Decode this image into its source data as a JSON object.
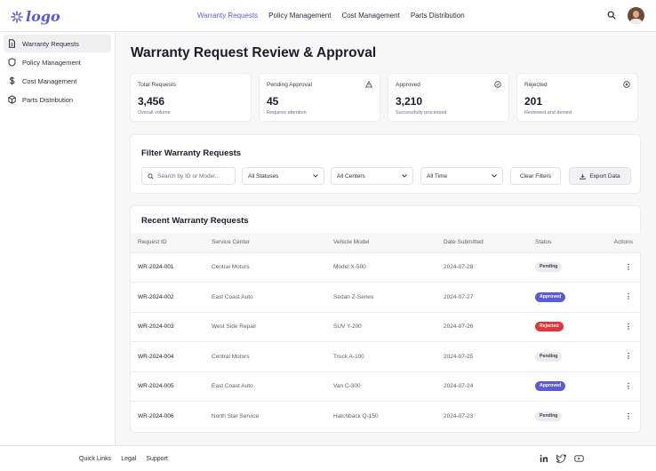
{
  "brand": {
    "logo_text": "logo",
    "accent": "#5b5bd6"
  },
  "topnav": {
    "items": [
      {
        "label": "Warranty Requests",
        "active": true
      },
      {
        "label": "Policy Management",
        "active": false
      },
      {
        "label": "Cost Management",
        "active": false
      },
      {
        "label": "Parts Distribution",
        "active": false
      }
    ],
    "icons": [
      "search-icon",
      "avatar"
    ]
  },
  "sidebar": {
    "items": [
      {
        "label": "Warranty Requests",
        "icon": "document-icon",
        "active": true
      },
      {
        "label": "Policy Management",
        "icon": "shield-icon",
        "active": false
      },
      {
        "label": "Cost Management",
        "icon": "dollar-icon",
        "active": false
      },
      {
        "label": "Parts Distribution",
        "icon": "package-icon",
        "active": false
      }
    ]
  },
  "page": {
    "title": "Warranty Request Review & Approval"
  },
  "stats": [
    {
      "label": "Total Requests",
      "value": "3,456",
      "sub": "Overall volume",
      "icon": ""
    },
    {
      "label": "Pending Approval",
      "value": "45",
      "sub": "Requires attention",
      "icon": "warning-icon"
    },
    {
      "label": "Approved",
      "value": "3,210",
      "sub": "Successfully processed",
      "icon": "check-circle-icon"
    },
    {
      "label": "Rejected",
      "value": "201",
      "sub": "Reviewed and denied",
      "icon": "x-circle-icon"
    }
  ],
  "filters": {
    "title": "Filter Warranty Requests",
    "search_placeholder": "Search by ID or Model...",
    "status": "All Statuses",
    "center": "All Centers",
    "time": "All Time",
    "clear_label": "Clear Filters",
    "export_label": "Export Data"
  },
  "table": {
    "title": "Recent Warranty Requests",
    "columns": [
      "Request ID",
      "Service Center",
      "Vehicle Model",
      "Date Submitted",
      "Status",
      "Actions"
    ],
    "rows": [
      {
        "id": "WR-2024-001",
        "center": "Central Motors",
        "model": "Model X-500",
        "date": "2024-07-28",
        "status": "Pending",
        "status_key": "pending"
      },
      {
        "id": "WR-2024-002",
        "center": "East Coast Auto",
        "model": "Sedan Z-Series",
        "date": "2024-07-27",
        "status": "Approved",
        "status_key": "approved"
      },
      {
        "id": "WR-2024-003",
        "center": "West Side Repair",
        "model": "SUV Y-200",
        "date": "2024-07-26",
        "status": "Rejected",
        "status_key": "rejected"
      },
      {
        "id": "WR-2024-004",
        "center": "Central Motors",
        "model": "Truck A-100",
        "date": "2024-07-25",
        "status": "Pending",
        "status_key": "pending"
      },
      {
        "id": "WR-2024-005",
        "center": "East Coast Auto",
        "model": "Van C-300",
        "date": "2024-07-24",
        "status": "Approved",
        "status_key": "approved"
      },
      {
        "id": "WR-2024-006",
        "center": "North Star Service",
        "model": "Hatchback Q-150",
        "date": "2024-07-23",
        "status": "Pending",
        "status_key": "pending"
      }
    ],
    "status_colors": {
      "approved": "#5b5bd6",
      "rejected": "#e0353b",
      "pending": "#ececee"
    }
  },
  "footer": {
    "links": [
      "Quick Links",
      "Legal",
      "Support"
    ],
    "social_icons": [
      "linkedin-icon",
      "twitter-icon",
      "youtube-icon"
    ]
  }
}
